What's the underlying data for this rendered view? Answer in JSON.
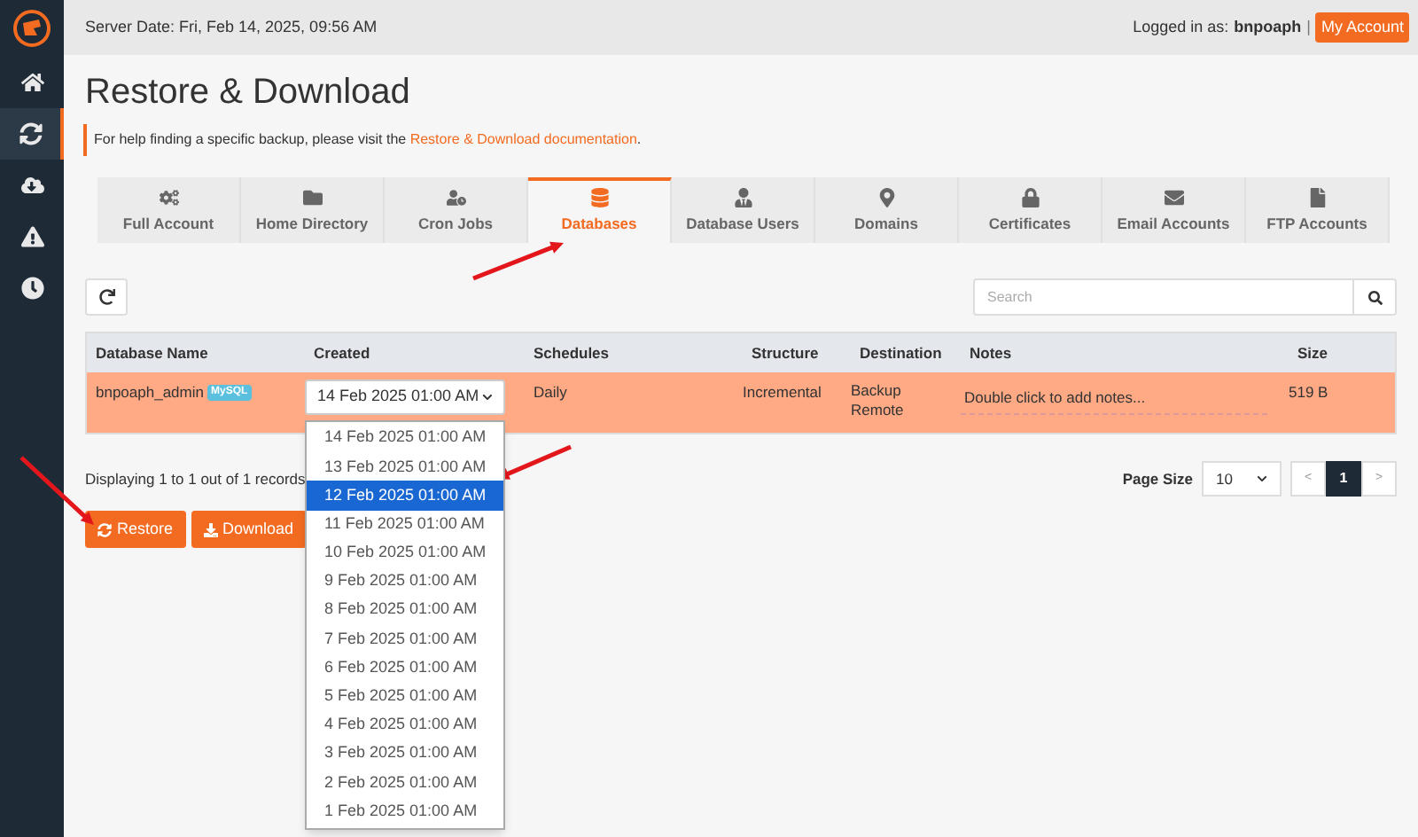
{
  "topbar": {
    "server_date": "Server Date: Fri, Feb 14, 2025, 09:56 AM",
    "logged_in_label": "Logged in as:",
    "username": "bnpoaph",
    "separator": "|",
    "account_button": "My Account"
  },
  "sidebar": {
    "items": [
      {
        "kind": "home",
        "selected": false
      },
      {
        "kind": "restore",
        "selected": true
      },
      {
        "kind": "download",
        "selected": false
      },
      {
        "kind": "alert",
        "selected": false
      },
      {
        "kind": "clock",
        "selected": false
      }
    ]
  },
  "page": {
    "title": "Restore & Download",
    "help_text": "For help finding a specific backup, please visit the ",
    "help_link": "Restore & Download documentation",
    "help_end": "."
  },
  "tabs": [
    {
      "label": "Full Account",
      "kind": "cogs",
      "selected": false
    },
    {
      "label": "Home Directory",
      "kind": "folder",
      "selected": false
    },
    {
      "label": "Cron Jobs",
      "kind": "cron",
      "selected": false
    },
    {
      "label": "Databases",
      "kind": "database",
      "selected": true
    },
    {
      "label": "Database Users",
      "kind": "user",
      "selected": false
    },
    {
      "label": "Domains",
      "kind": "pin",
      "selected": false
    },
    {
      "label": "Certificates",
      "kind": "lock",
      "selected": false
    },
    {
      "label": "Email Accounts",
      "kind": "envelope",
      "selected": false
    },
    {
      "label": "FTP Accounts",
      "kind": "file",
      "selected": false
    }
  ],
  "search": {
    "placeholder": "Search"
  },
  "table": {
    "columns": [
      "Database Name",
      "Created",
      "Schedules",
      "Structure",
      "Destination",
      "Notes",
      "Size"
    ],
    "rows": [
      {
        "name": "bnpoaph_admin",
        "badge": "MySQL",
        "created": "14 Feb 2025 01:00 AM",
        "schedules": "Daily",
        "structure": "Incremental",
        "destination": [
          "Backup",
          "Remote"
        ],
        "notes_placeholder": "Double click to add notes...",
        "size": "519 B",
        "selected": true
      }
    ]
  },
  "created_dropdown": {
    "options": [
      {
        "label": "14 Feb 2025 01:00 AM",
        "selected": false
      },
      {
        "label": "13 Feb 2025 01:00 AM",
        "selected": false
      },
      {
        "label": "12 Feb 2025 01:00 AM",
        "selected": true
      },
      {
        "label": "11 Feb 2025 01:00 AM",
        "selected": false
      },
      {
        "label": "10 Feb 2025 01:00 AM",
        "selected": false
      },
      {
        "label": "9 Feb 2025 01:00 AM",
        "selected": false
      },
      {
        "label": "8 Feb 2025 01:00 AM",
        "selected": false
      },
      {
        "label": "7 Feb 2025 01:00 AM",
        "selected": false
      },
      {
        "label": "6 Feb 2025 01:00 AM",
        "selected": false
      },
      {
        "label": "5 Feb 2025 01:00 AM",
        "selected": false
      },
      {
        "label": "4 Feb 2025 01:00 AM",
        "selected": false
      },
      {
        "label": "3 Feb 2025 01:00 AM",
        "selected": false
      },
      {
        "label": "2 Feb 2025 01:00 AM",
        "selected": false
      },
      {
        "label": "1 Feb 2025 01:00 AM",
        "selected": false
      }
    ]
  },
  "records_text": "Displaying 1 to 1 out of 1 records",
  "pagination": {
    "page_size_label": "Page Size",
    "page_size": "10",
    "prev": "<",
    "pages": [
      {
        "label": "1",
        "selected": true
      }
    ],
    "next": ">"
  },
  "actions": [
    {
      "label": "Restore",
      "kind": "restore"
    },
    {
      "label": "Download",
      "kind": "download"
    }
  ]
}
